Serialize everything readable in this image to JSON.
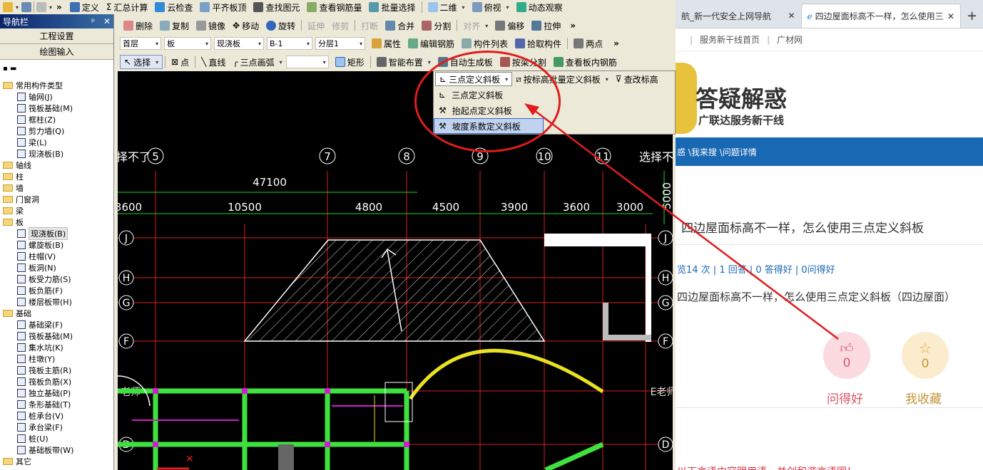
{
  "app": {
    "nav_title": "导航栏",
    "nav_pin": "ᵖ",
    "nav_close": "✕",
    "btn_project_settings": "工程设置",
    "btn_drawing_input": "绘图输入"
  },
  "toolbar1": {
    "define": "定义",
    "sum_calc": "汇总计算",
    "cloud_check": "云检查",
    "flush_slab_top": "平齐板顶",
    "find_element": "查找图元",
    "view_rebar": "查看钢筋量",
    "batch_select": "批量选择",
    "view_2d": "二维",
    "top_view": "俯视",
    "dynamic_view": "动态观察"
  },
  "toolbar2": {
    "delete": "删除",
    "copy": "复制",
    "mirror": "镜像",
    "move": "移动",
    "rotate": "旋转",
    "extend": "延伸",
    "trim": "修剪",
    "break": "打断",
    "merge": "合并",
    "split": "分割",
    "align": "对齐",
    "offset": "偏移",
    "stretch": "拉伸"
  },
  "toolbar3": {
    "floor": "首层",
    "type": "板",
    "subtype": "现浇板",
    "name": "B-1",
    "layer": "分层1",
    "props": "属性",
    "edit_rebar": "编辑钢筋",
    "comp_list": "构件列表",
    "pick_comp": "拾取构件",
    "two_points": "两点"
  },
  "toolbar4": {
    "select": "选择",
    "point": "点",
    "line": "直线",
    "arc3": "三点画弧",
    "rect": "矩形",
    "smart_layout": "智能布置",
    "auto_gen_slab": "自动生成板",
    "split_by_beam": "按梁分割",
    "view_slab_rebar": "查看板内钢筋"
  },
  "dropdown": {
    "three_point_slope": "三点定义斜板",
    "batch_by_elev": "按标高批量定义斜板",
    "change_elev": "查改标高",
    "items": [
      "三点定义斜板",
      "抬起点定义斜板",
      "坡度系数定义斜板"
    ]
  },
  "tree": [
    {
      "label": "常用构件类型",
      "level": 0
    },
    {
      "label": "轴网(J)",
      "level": 1
    },
    {
      "label": "筏板基础(M)",
      "level": 1
    },
    {
      "label": "框柱(Z)",
      "level": 1
    },
    {
      "label": "剪力墙(Q)",
      "level": 1
    },
    {
      "label": "梁(L)",
      "level": 1
    },
    {
      "label": "现浇板(B)",
      "level": 1
    },
    {
      "label": "轴线",
      "level": 0
    },
    {
      "label": "柱",
      "level": 0
    },
    {
      "label": "墙",
      "level": 0
    },
    {
      "label": "门窗洞",
      "level": 0
    },
    {
      "label": "梁",
      "level": 0
    },
    {
      "label": "板",
      "level": 0
    },
    {
      "label": "现浇板(B)",
      "level": 1
    },
    {
      "label": "螺旋板(B)",
      "level": 1
    },
    {
      "label": "柱帽(V)",
      "level": 1
    },
    {
      "label": "板洞(N)",
      "level": 1
    },
    {
      "label": "板受力筋(S)",
      "level": 1
    },
    {
      "label": "板负筋(F)",
      "level": 1
    },
    {
      "label": "楼层板带(H)",
      "level": 1
    },
    {
      "label": "基础",
      "level": 0
    },
    {
      "label": "基础梁(F)",
      "level": 1
    },
    {
      "label": "筏板基础(M)",
      "level": 1
    },
    {
      "label": "集水坑(K)",
      "level": 1
    },
    {
      "label": "柱墩(Y)",
      "level": 1
    },
    {
      "label": "筏板主筋(R)",
      "level": 1
    },
    {
      "label": "筏板负筋(X)",
      "level": 1
    },
    {
      "label": "独立基础(P)",
      "level": 1
    },
    {
      "label": "条形基础(T)",
      "level": 1
    },
    {
      "label": "桩承台(V)",
      "level": 1
    },
    {
      "label": "承台梁(F)",
      "level": 1
    },
    {
      "label": "桩(U)",
      "level": 1
    },
    {
      "label": "基础板带(W)",
      "level": 1
    },
    {
      "label": "其它",
      "level": 0
    }
  ],
  "drawing": {
    "axes_top": [
      "5",
      "7",
      "8",
      "9",
      "10",
      "11"
    ],
    "axes_side": [
      "J",
      "H",
      "G",
      "F",
      "E",
      "D"
    ],
    "total_dim": "47100",
    "dims": [
      "3600",
      "10500",
      "4800",
      "4500",
      "3900",
      "3600",
      "3000"
    ],
    "side_dim": "5000",
    "label_left": "择不了",
    "label_right": "选择不",
    "label_laoshi": "老师",
    "label_elaoshi": "E老师"
  },
  "browser": {
    "tab1": "航_新一代安全上网导航",
    "tab2": "四边屋面标高不一样，怎么使用三",
    "new_tab": "+",
    "close": "✕",
    "fav": [
      "服务新干线首页",
      "广材网"
    ],
    "banner_title": "答疑解惑",
    "banner_sub": "广联达服务新干线",
    "breadcrumb": "惑 \\我来搜 \\问题详情",
    "question_title": "四边屋面标高不一样，怎么使用三点定义斜板",
    "stats": "览14 次 | 1 回答 | 0 答得好 | 0问得好",
    "question_body": "四边屋面标高不一样，怎么使用三点定义斜板（四边屋面）",
    "like_count": "0",
    "like_label": "问得好",
    "fav_count": "0",
    "fav_label": "我收藏",
    "footer_text": "以下言语内容明用语，并创和谐言语圈！"
  }
}
